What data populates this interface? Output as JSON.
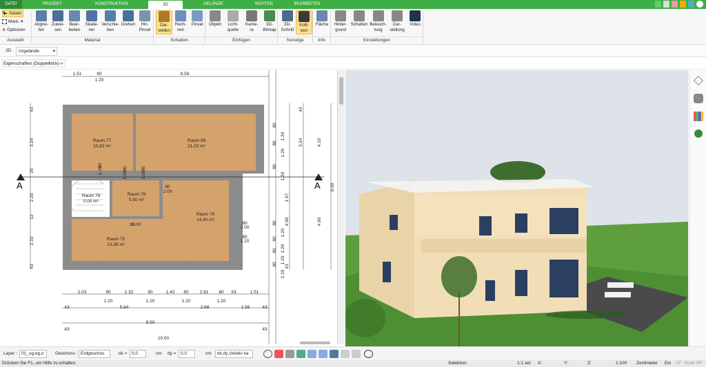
{
  "tabs": [
    "DATEI",
    "PROJEKT",
    "KONSTRUKTION",
    "3D",
    "GELÄNDE",
    "SICHTEN",
    "BEARBEITEN"
  ],
  "ribbon": {
    "auswahl": {
      "select": "Selekt",
      "mark": "Mark.",
      "options": "Optionen",
      "group": "Auswahl"
    },
    "material": {
      "buttons": [
        [
          "Abgrei-",
          "fen"
        ],
        [
          "Zuwei-",
          "sen"
        ],
        [
          "Bear-",
          "beiten"
        ],
        [
          "Skalie-",
          "ren"
        ],
        [
          "Verschie-",
          "ben"
        ],
        [
          "Drehen",
          ""
        ],
        [
          "Hin.",
          "Pinsel"
        ]
      ],
      "group": "Material"
    },
    "schatten": {
      "buttons": [
        [
          "Dar-",
          "stellen"
        ],
        [
          "Rech-",
          "nen"
        ],
        [
          "Pinsel",
          ""
        ]
      ],
      "group": "Schatten"
    },
    "einfuegen": {
      "buttons": [
        [
          "Objekt",
          ""
        ],
        [
          "Licht-",
          "quelle"
        ],
        [
          "Kame-",
          "ra"
        ],
        [
          "3D-",
          "Bitmap"
        ]
      ],
      "group": "Einfügen"
    },
    "sonstige": {
      "buttons": [
        [
          "3D-",
          "Schnitt"
        ],
        [
          "Kolli-",
          "sion"
        ]
      ],
      "group": "Sonstige"
    },
    "info": {
      "buttons": [
        [
          "Fläche",
          ""
        ]
      ],
      "group": "Info"
    },
    "einstellungen": {
      "buttons": [
        [
          "Hinter-",
          "grund"
        ],
        [
          "Schatten",
          ""
        ],
        [
          "Beleuch-",
          "tung"
        ],
        [
          "Dar-",
          "stellung"
        ],
        [
          "Video",
          ""
        ]
      ],
      "group": "Einstellungen"
    }
  },
  "viewbar": {
    "mode": "3D",
    "terrain": "Urgelände"
  },
  "props": "Eigenschaften (Doppelklick)->",
  "plan": {
    "rooms": [
      {
        "name": "Raum 77",
        "area": "10,82 m²"
      },
      {
        "name": "Raum 69",
        "area": "21,02 m²"
      },
      {
        "name": "Raum 78",
        "area": "0,00 m²"
      },
      {
        "name": "Raum 79",
        "area": "5,50 m²"
      },
      {
        "name": "Raum 76",
        "area": "14,40 m²"
      },
      {
        "name": "Raum 75",
        "area": "13,36 m²"
      }
    ],
    "dims_top": [
      "1.51",
      "90",
      "8.59",
      "1.20"
    ],
    "dims_bottom1": [
      "2.03",
      "90",
      "1.32",
      "90",
      "1.42",
      "80",
      "2.81",
      "80",
      "53",
      "1.51"
    ],
    "dims_bottom1_sub": [
      "1.20",
      "1.20",
      "1.20",
      "1.20"
    ],
    "dims_bottom2": [
      "43",
      "5.84",
      "2.68",
      "1.56",
      "43"
    ],
    "dims_bottom3": [
      "9.50",
      "43",
      "43"
    ],
    "dims_bottom4": "10.00",
    "dims_left": [
      "43",
      "3.24",
      "25",
      "2.20",
      "12",
      "2.33",
      "43"
    ],
    "dims_right_a": [
      "80",
      "1.20",
      "80",
      "1.20",
      "80",
      "1.20",
      "80",
      "1.20",
      "80",
      "1.20",
      "80",
      "1.20",
      "80",
      "1.20"
    ],
    "dims_right_b": [
      "43",
      "3.24",
      "4.10",
      "1.97",
      "4.90",
      "4.90",
      "43",
      "9.00"
    ],
    "door_labels": [
      "80",
      "2.00",
      "80",
      "2.00",
      "80",
      "2.00",
      "80",
      "2.00",
      "80",
      "2.00",
      "80",
      "1.20",
      "80",
      "1.20"
    ],
    "section_label": "A"
  },
  "statusctl": {
    "layer_label": "Layer :",
    "layer": "01_ug,eg,o",
    "geschoss_label": "Geschoss :",
    "geschoss": "Erdgeschos",
    "dx": "dx =",
    "dx_val": "0,0",
    "dy": "dy =",
    "dy_val": "0,0",
    "unit": "cm",
    "mode": "dx,dy (relativ ka"
  },
  "statusbar": {
    "hint": "Drücken Sie F1, um Hilfe zu erhalten.",
    "mode": "Selektion",
    "scale": "1:1 sel",
    "x": "X:",
    "y": "Y:",
    "z": "Z:",
    "ratio": "1:100",
    "unit": "Zentimeter",
    "ein": "Ein",
    "uf": "UF",
    "num": "NUM",
    "rf": "RF"
  },
  "colors": {
    "accent": "#3fae45",
    "active": "#fde28f",
    "floor": "#d9a26a",
    "wall": "#8c8c8c"
  }
}
